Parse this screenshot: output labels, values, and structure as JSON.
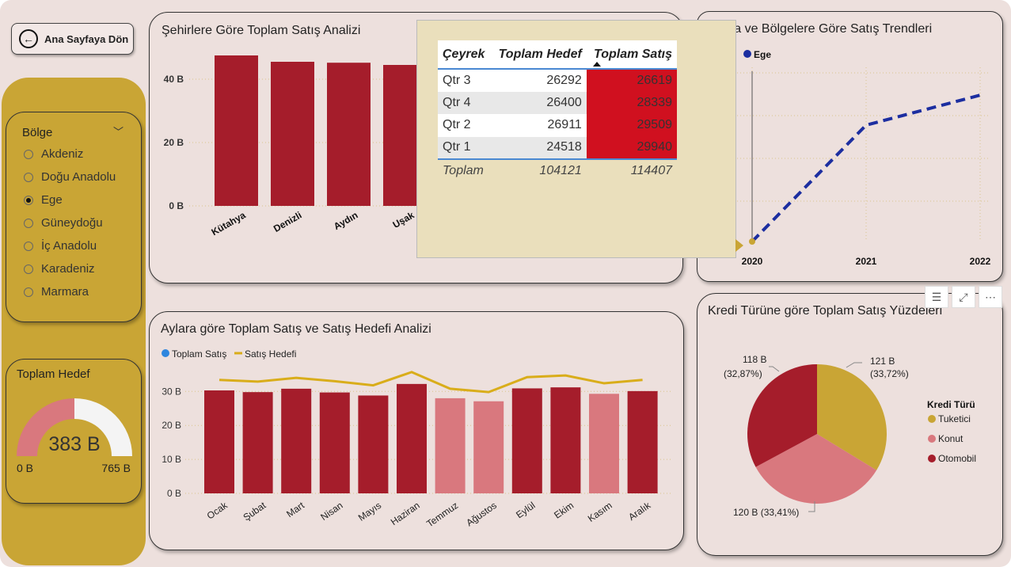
{
  "nav": {
    "back_label": "Ana Sayfaya Dön"
  },
  "slicer": {
    "title": "Bölge",
    "options": [
      "Akdeniz",
      "Doğu Anadolu",
      "Ege",
      "Güneydoğu",
      "İç Anadolu",
      "Karadeniz",
      "Marmara"
    ],
    "selected_index": 2
  },
  "gauge": {
    "title": "Toplam Hedef",
    "value_label": "383 B",
    "min_label": "0 B",
    "max_label": "765 B",
    "fill_fraction": 0.5,
    "fill_color": "#d9787e",
    "track_color": "#f4f4f4"
  },
  "panels": {
    "city_title": "Şehirlere Göre Toplam Satış Analizi",
    "trend_title": "ara ve Bölgelere Göre Satış Trendleri",
    "month_title": "Aylara göre Toplam Satış ve Satış Hedefi Analizi",
    "pie_title": "Kredi Türüne göre Toplam Satış Yüzdeleri"
  },
  "colors": {
    "bar": "#a51d2b",
    "bar_light": "#d9787e",
    "line_gold": "#d9ad1a",
    "trend_blue": "#1c2ea0",
    "pie_gold": "#c9a535"
  },
  "tooltip": {
    "headers": [
      "Çeyrek",
      "Toplam Hedef",
      "Toplam Satış"
    ],
    "rows": [
      [
        "Qtr 3",
        "26292",
        "26619"
      ],
      [
        "Qtr 4",
        "26400",
        "28339"
      ],
      [
        "Qtr 2",
        "26911",
        "29509"
      ],
      [
        "Qtr 1",
        "24518",
        "29940"
      ]
    ],
    "total": [
      "Toplam",
      "104121",
      "114407"
    ]
  },
  "toolbar": {
    "filter_icon": "filter-icon",
    "focus_icon": "focus-mode-icon",
    "more_icon": "more-options-icon"
  },
  "chart_data": [
    {
      "type": "bar",
      "title": "Şehirlere Göre Toplam Satış Analizi",
      "categories": [
        "Kütahya",
        "Denizli",
        "Aydın",
        "Uşak"
      ],
      "values": [
        47.5,
        45.5,
        45.2,
        44.5
      ],
      "ylim": [
        0,
        50
      ],
      "yticks": [
        0,
        20,
        40
      ],
      "ytick_labels": [
        "0 B",
        "20 B",
        "40 B"
      ],
      "grid": true
    },
    {
      "type": "line",
      "title": "ara ve Bölgelere Göre Satış Trendleri",
      "x": [
        "2020",
        "2021",
        "2022"
      ],
      "series": [
        {
          "name": "Ege",
          "values": [
            0,
            0.7,
            0.88
          ],
          "style": "dashed"
        }
      ],
      "legend": "top-left",
      "grid": true
    },
    {
      "type": "bar",
      "title": "Aylara göre Toplam Satış ve Satış Hedefi Analizi",
      "categories": [
        "Ocak",
        "Şubat",
        "Mart",
        "Nisan",
        "Mayıs",
        "Haziran",
        "Temmuz",
        "Ağustos",
        "Eylül",
        "Ekim",
        "Kasım",
        "Aralık"
      ],
      "series": [
        {
          "name": "Toplam Satış",
          "kind": "bar",
          "values": [
            30.3,
            29.8,
            30.8,
            29.7,
            28.8,
            32.2,
            28.0,
            27.1,
            30.9,
            31.2,
            29.3,
            30.1
          ],
          "highlight": [
            true,
            true,
            true,
            true,
            true,
            true,
            false,
            false,
            true,
            true,
            false,
            true
          ]
        },
        {
          "name": "Satış Hedefi",
          "kind": "line",
          "values": [
            33.4,
            32.9,
            34.0,
            33.0,
            31.8,
            35.7,
            30.8,
            29.8,
            34.2,
            34.7,
            32.4,
            33.4
          ]
        }
      ],
      "ylim": [
        0,
        36
      ],
      "yticks": [
        0,
        10,
        20,
        30
      ],
      "ytick_labels": [
        "0 B",
        "10 B",
        "20 B",
        "30 B"
      ],
      "legend": "top-left",
      "grid": true
    },
    {
      "type": "pie",
      "title": "Kredi Türüne göre Toplam Satış Yüzdeleri",
      "legend_title": "Kredi Türü",
      "categories": [
        "Tuketici",
        "Konut",
        "Otomobil"
      ],
      "values": [
        121,
        120,
        118
      ],
      "percents": [
        33.72,
        33.41,
        32.87
      ],
      "labels": [
        [
          "121 B",
          "(33,72%)"
        ],
        [
          "120 B (33,41%)"
        ],
        [
          "118 B",
          "(32,87%)"
        ]
      ],
      "colors": [
        "#c9a535",
        "#d9787e",
        "#a51d2b"
      ],
      "legend": "right"
    }
  ]
}
